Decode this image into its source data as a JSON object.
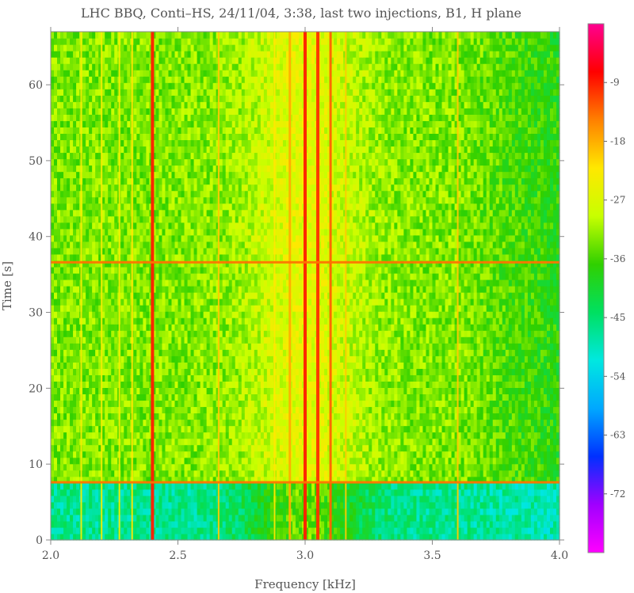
{
  "chart_data": {
    "type": "heatmap",
    "title": "LHC BBQ,  Conti–HS,  24/11/04,  3:38,  last two injections,  B1,  H plane",
    "xlabel": "Frequency  [kHz]",
    "ylabel": "Time  [s]",
    "xlim": [
      2.0,
      4.0
    ],
    "ylim": [
      0,
      67
    ],
    "x_ticks": [
      "2.0",
      "2.5",
      "3.0",
      "3.5",
      "4.0"
    ],
    "y_ticks": [
      "0",
      "10",
      "20",
      "30",
      "40",
      "50",
      "60"
    ],
    "x_tick_values": [
      2.0,
      2.5,
      3.0,
      3.5,
      4.0
    ],
    "y_tick_values": [
      0,
      10,
      20,
      30,
      40,
      50,
      60
    ],
    "grid": false,
    "colorbar": {
      "ticks": [
        "-9",
        "-18",
        "-27",
        "-36",
        "-45",
        "-54",
        "-63",
        "-72"
      ],
      "tick_values": [
        -9,
        -18,
        -27,
        -36,
        -45,
        -54,
        -63,
        -72
      ],
      "range": [
        -81,
        0
      ],
      "colors_low_to_high": [
        "#ff00ff",
        "#a000ff",
        "#0030ff",
        "#00a8ff",
        "#00e8e0",
        "#00e060",
        "#30d000",
        "#c8ff00",
        "#ffe800",
        "#ff8000",
        "#ff0000",
        "#ff0090"
      ]
    },
    "vertical_lines_kHz": [
      {
        "x": 2.4,
        "level": -9
      },
      {
        "x": 3.0,
        "level": -9
      },
      {
        "x": 3.05,
        "level": -10
      },
      {
        "x": 3.1,
        "level": -13
      },
      {
        "x": 3.6,
        "level": -20
      },
      {
        "x": 2.66,
        "level": -20
      },
      {
        "x": 2.12,
        "level": -24
      },
      {
        "x": 2.2,
        "level": -24
      },
      {
        "x": 2.27,
        "level": -24
      },
      {
        "x": 2.32,
        "level": -22
      },
      {
        "x": 2.88,
        "level": -22
      },
      {
        "x": 2.94,
        "level": -18
      },
      {
        "x": 3.16,
        "level": -20
      }
    ],
    "horizontal_events_s": [
      {
        "t": 7.6,
        "level": -14
      },
      {
        "t": 36.6,
        "level": -14
      }
    ],
    "background_levels_dB": {
      "before_first_injection": -47,
      "after_first_injection": -33,
      "center_band": -28
    }
  }
}
